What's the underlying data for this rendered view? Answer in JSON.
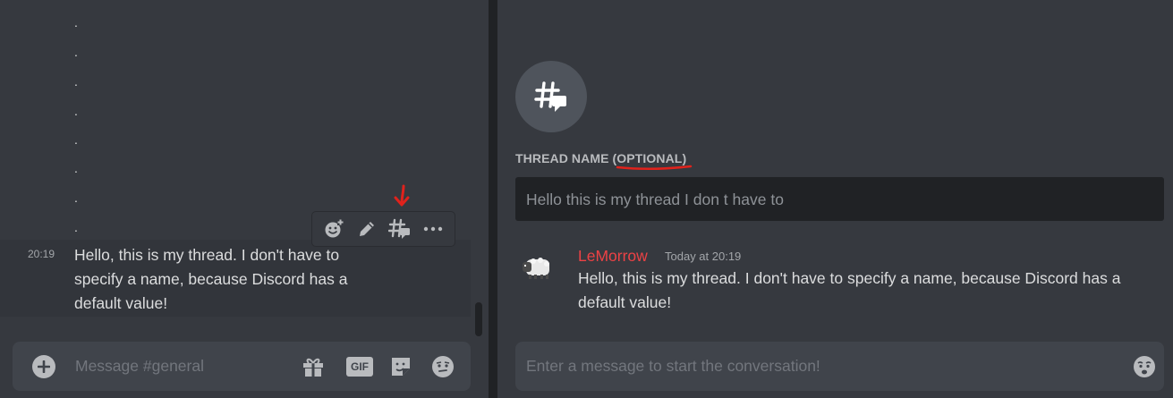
{
  "left": {
    "dots": [
      ".",
      ".",
      ".",
      ".",
      ".",
      ".",
      ".",
      "."
    ],
    "message": {
      "time": "20:19",
      "text": "Hello, this is my thread. I don't have to specify a name, because Discord has a default value!"
    },
    "hover_toolbar": {
      "icons": [
        "add-reaction-icon",
        "edit-icon",
        "create-thread-icon",
        "more-icon"
      ]
    },
    "composer": {
      "placeholder": "Message #general",
      "gif_label": "GIF"
    }
  },
  "right": {
    "thread_name_label": "THREAD NAME",
    "thread_name_optional": "(OPTIONAL)",
    "thread_name_value": "Hello this is my thread I don t have to",
    "message": {
      "author": "LeMorrow",
      "timestamp": "Today at 20:19",
      "text": "Hello, this is my thread. I don't have to specify a name, because Discord has a default value!"
    },
    "composer": {
      "placeholder": "Enter a message to start the conversation!"
    }
  },
  "colors": {
    "background": "#36393f",
    "input_background": "#40444b",
    "author_red": "#ed4245",
    "annotation_red": "#e0221c"
  }
}
